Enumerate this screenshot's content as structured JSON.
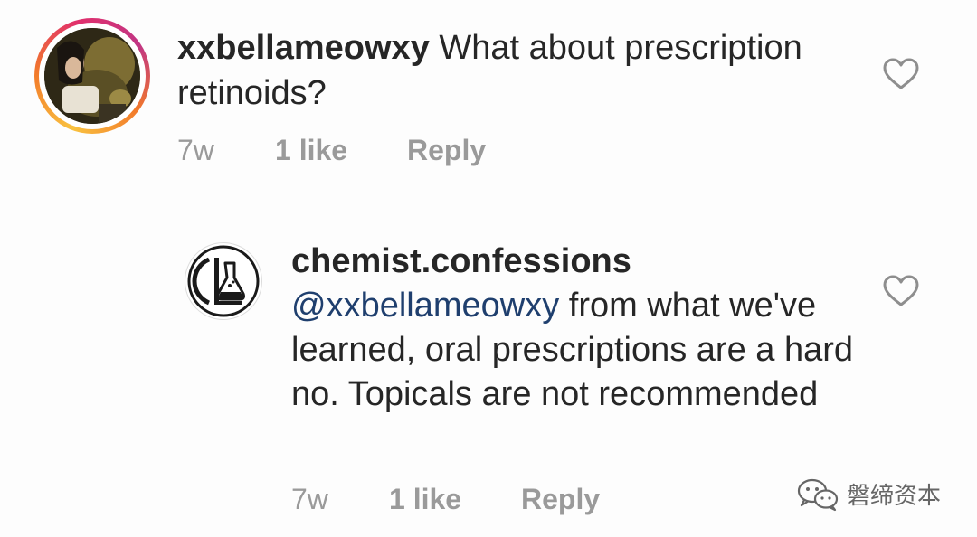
{
  "comments": [
    {
      "username": "xxbellameowxy",
      "text": "What about prescription retinoids?",
      "time": "7w",
      "likes": "1 like",
      "reply_label": "Reply",
      "avatar_icon": "user-photo-avatar",
      "like_icon": "heart-outline-icon",
      "has_story_ring": true
    },
    {
      "username": "chemist.confessions",
      "mention": "@xxbellameowxy",
      "text": "from what we've learned, oral prescriptions are a hard no. Topicals are not recommended",
      "time": "7w",
      "likes": "1 like",
      "reply_label": "Reply",
      "avatar_icon": "chemist-confessions-logo",
      "like_icon": "heart-outline-icon",
      "has_story_ring": false
    }
  ],
  "watermark": {
    "icon": "wechat-icon",
    "text": "磐缔资本"
  },
  "colors": {
    "text": "#262626",
    "meta": "#9a9a9a",
    "mention": "#1f3f6e",
    "story_ring": [
      "#f9c240",
      "#f27a2a",
      "#e1306c",
      "#c13584"
    ]
  }
}
